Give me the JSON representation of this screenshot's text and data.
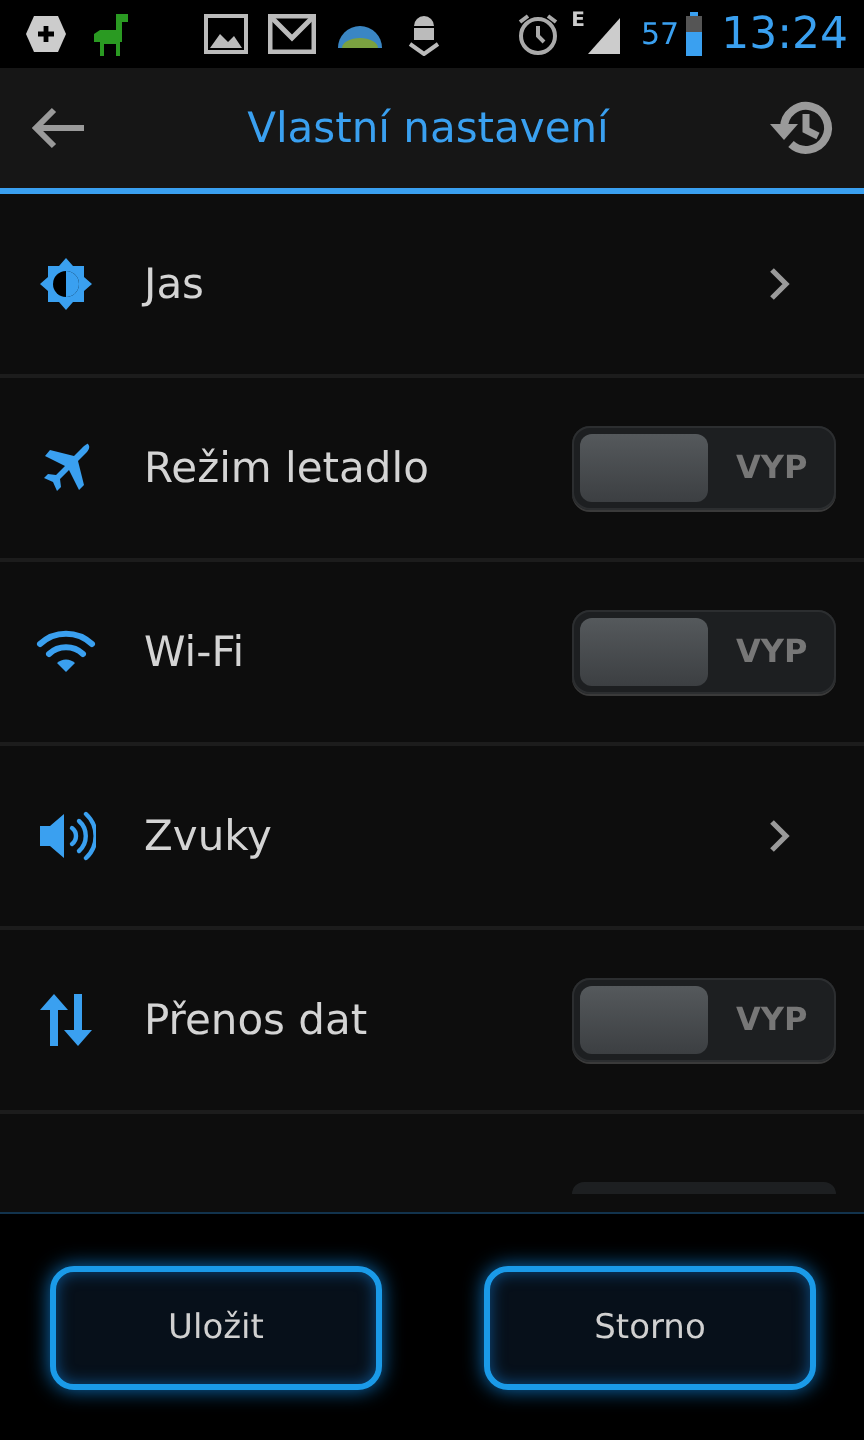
{
  "status_bar": {
    "network_type": "E",
    "battery": "57",
    "time": "13:24"
  },
  "header": {
    "title": "Vlastní nastavení"
  },
  "rows": [
    {
      "kind": "nav",
      "label": "Jas"
    },
    {
      "kind": "toggle",
      "label": "Režim letadlo",
      "on": false,
      "state_label": "VYP"
    },
    {
      "kind": "toggle",
      "label": "Wi-Fi",
      "on": false,
      "state_label": "VYP"
    },
    {
      "kind": "nav",
      "label": "Zvuky"
    },
    {
      "kind": "toggle",
      "label": "Přenos dat",
      "on": false,
      "state_label": "VYP"
    }
  ],
  "buttons": [
    "Uložit",
    "Storno"
  ]
}
